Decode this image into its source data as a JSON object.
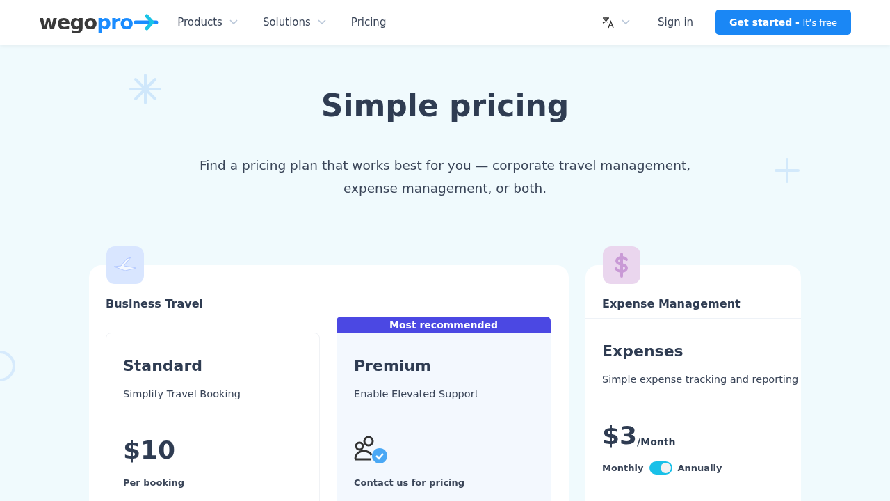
{
  "navbar": {
    "logo": {
      "dark": "wego",
      "accent": "pro"
    },
    "menu": [
      {
        "label": "Products",
        "dropdown": true
      },
      {
        "label": "Solutions",
        "dropdown": true
      },
      {
        "label": "Pricing",
        "dropdown": false
      }
    ],
    "sign_in": "Sign in",
    "cta": {
      "label": "Get started -",
      "note": "It’s free"
    }
  },
  "hero": {
    "title": "Simple pricing",
    "subtitle": "Find a pricing plan that works best for you — corporate travel management, expense management, or both."
  },
  "groups": [
    {
      "kind": "travel",
      "title": "Business Travel",
      "plans": [
        {
          "name": "Standard",
          "description": "Simplify Travel Booking",
          "kind": "amount",
          "price": "$10",
          "note": "Per booking"
        },
        {
          "name": "Premium",
          "description": "Enable Elevated Support",
          "badge": "Most recommended",
          "kind": "contact",
          "note": "Contact us for pricing"
        }
      ]
    },
    {
      "kind": "expense",
      "title": "Expense Management",
      "plans": [
        {
          "name": "Expenses",
          "description": "Simple expense tracking and reporting",
          "kind": "amount",
          "price": "$3",
          "unit": "/Month",
          "toggle": {
            "left": "Monthly",
            "right": "Annually",
            "on": true
          }
        }
      ]
    }
  ]
}
